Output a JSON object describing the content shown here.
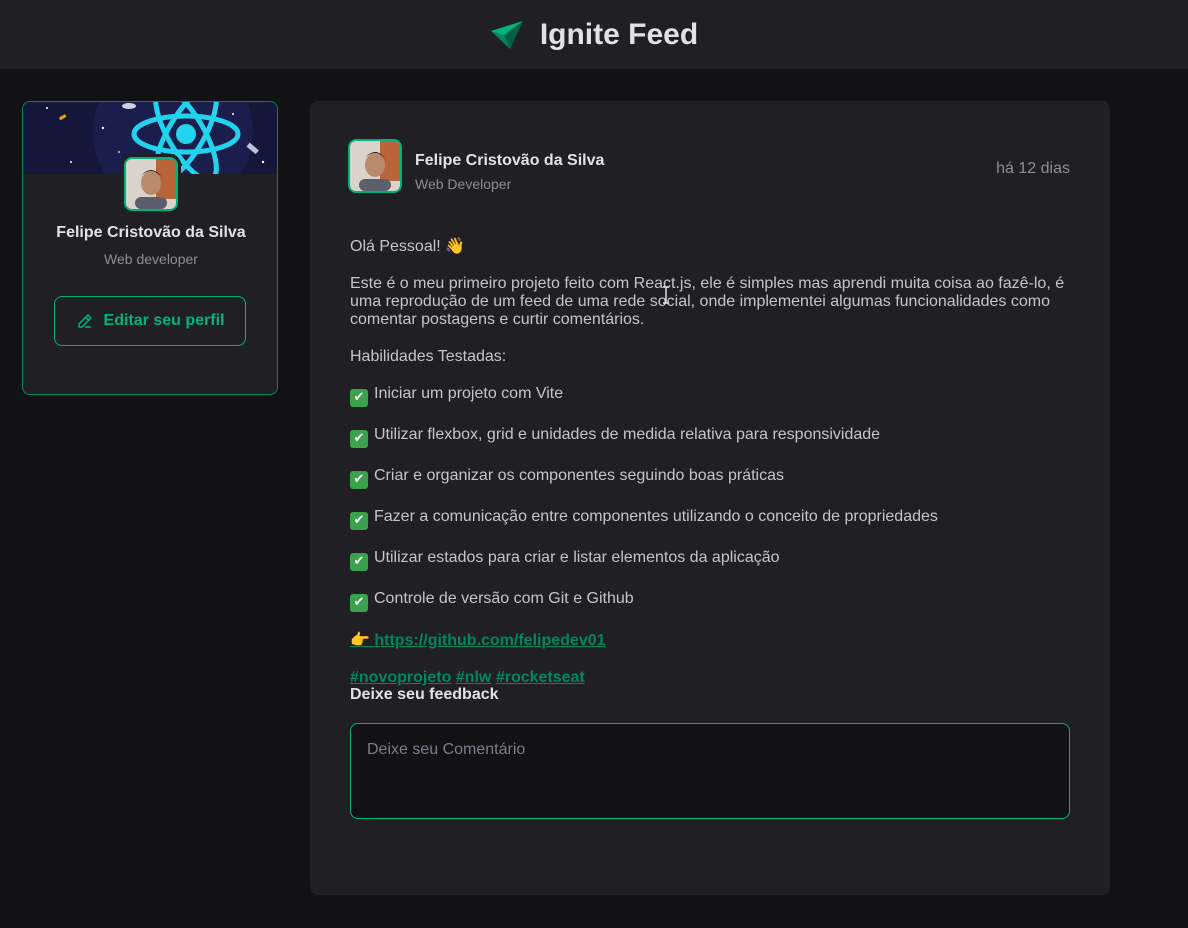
{
  "header": {
    "logo_icon": "ignite-logo-icon",
    "title": "Ignite Feed"
  },
  "sidebar": {
    "cover_icon": "react-atom-illustration",
    "name": "Felipe Cristovão da Silva",
    "role": "Web developer",
    "edit_button": {
      "icon": "pencil-icon",
      "label": "Editar seu perfil"
    }
  },
  "post": {
    "author": {
      "name": "Felipe Cristovão da Silva",
      "role": "Web Developer"
    },
    "published": "há 12 dias",
    "greeting": "Olá Pessoal!",
    "greeting_emoji": "👋",
    "intro": "Este é o meu primeiro projeto feito com React.js, ele é simples mas aprendi muita coisa ao fazê-lo, é uma reprodução de um feed de uma rede social, onde implementei algumas funcionalidades como comentar postagens e curtir comentários.",
    "skills_title": "Habilidades Testadas:",
    "check_icon": "✔",
    "skills": [
      "Iniciar um projeto com Vite",
      "Utilizar flexbox, grid e unidades de medida relativa para responsividade",
      "Criar e organizar os componentes seguindo boas práticas",
      "Fazer a comunicação entre componentes utilizando o conceito de propriedades",
      "Utilizar estados para criar e listar elementos da aplicação",
      "Controle de versão com Git e Github"
    ],
    "link_emoji": "👉",
    "link": "https://github.com/felipedev01",
    "hashtags": [
      "#novoprojeto",
      "#nlw",
      "#rocketseat"
    ],
    "feedback_title": "Deixe seu feedback",
    "comment_placeholder": "Deixe seu Comentário",
    "comment_value": ""
  },
  "colors": {
    "background": "#121214",
    "panel": "#202024",
    "accent": "#00b37e",
    "accent_dark": "#00875f",
    "text": "#c4c4cc",
    "heading": "#e1e1e6",
    "muted": "#8d8d99"
  }
}
